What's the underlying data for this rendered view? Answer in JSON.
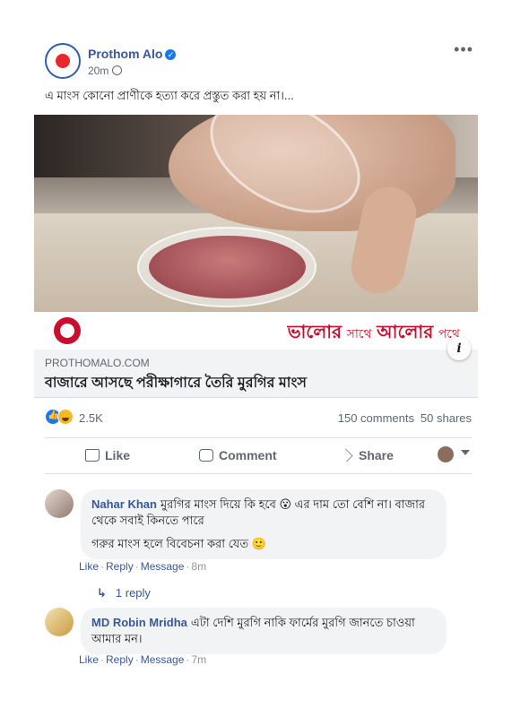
{
  "post": {
    "page_name": "Prothom Alo",
    "timestamp": "20m",
    "caption": "এ মাংস কোনো প্রাণীকে হত্যা করে প্রস্তুত করা হয় না।...",
    "more_icon": "ellipsis-icon"
  },
  "brand": {
    "slogan_1": "ভালোর",
    "slogan_2": "সাথে",
    "slogan_3": "আলোর",
    "slogan_4": "পথে",
    "color": "#c8102e"
  },
  "link": {
    "domain": "PROTHOMALO.COM",
    "title": "বাজারে আসছে পরীক্ষাগারে তৈরি মুরগির মাংস",
    "info": "i"
  },
  "stats": {
    "reactions": "2.5K",
    "comments": "150 comments",
    "shares": "50 shares"
  },
  "actions": {
    "like": "Like",
    "comment": "Comment",
    "share": "Share"
  },
  "comments": [
    {
      "author": "Nahar Khan",
      "text": "মুরগির মাংস দিয়ে কি হবে 😮 এর দাম তো বেশি না। বাজার থেকে সবাই কিনতে পারে",
      "text2": "গরুর মাংস হলে বিবেচনা করা যেত 🙂",
      "like": "Like",
      "reply": "Reply",
      "message": "Message",
      "time": "8m",
      "replies": "1 reply"
    },
    {
      "author": "MD Robin Mridha",
      "text": "এটা দেশি মুরগি নাকি ফার্মের মুরগি জানতে চাওয়া আমার মন।",
      "like": "Like",
      "reply": "Reply",
      "message": "Message",
      "time": "7m"
    }
  ],
  "colors": {
    "link_blue": "#385898",
    "facebook_blue": "#1877f2",
    "muted": "#606770"
  }
}
